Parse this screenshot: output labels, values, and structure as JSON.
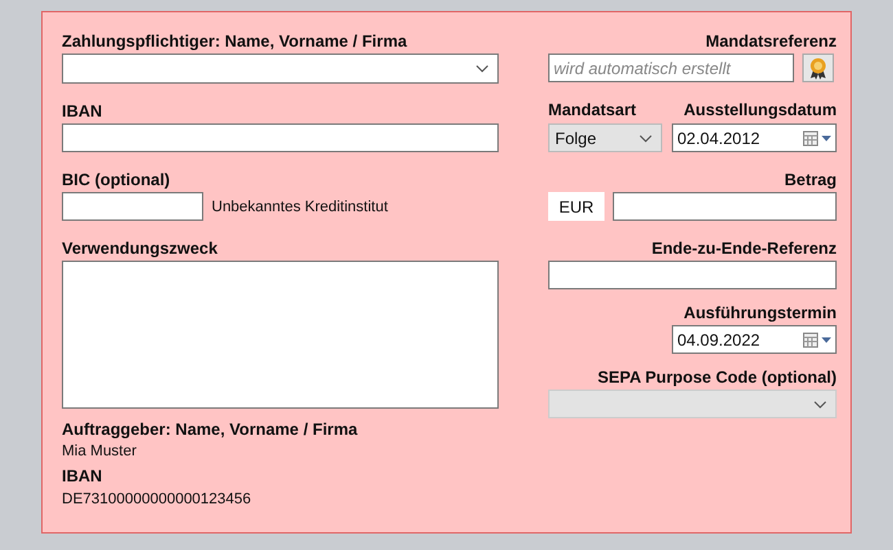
{
  "payer": {
    "label": "Zahlungspflichtiger: Name, Vorname / Firma"
  },
  "iban": {
    "label": "IBAN"
  },
  "bic": {
    "label": "BIC (optional)",
    "bank": "Unbekanntes Kreditinstitut"
  },
  "purpose": {
    "label": "Verwendungszweck"
  },
  "originator": {
    "label": "Auftraggeber: Name, Vorname / Firma",
    "name": "Mia Muster",
    "iban_label": "IBAN",
    "iban": "DE73100000000000123456"
  },
  "mandate_reference": {
    "label": "Mandatsreferenz",
    "placeholder": "wird automatisch erstellt"
  },
  "mandate_type": {
    "label": "Mandatsart",
    "value": "Folge"
  },
  "issue_date": {
    "label": "Ausstellungsdatum",
    "value": "02.04.2012"
  },
  "amount": {
    "label": "Betrag",
    "currency": "EUR"
  },
  "end_to_end": {
    "label": "Ende-zu-Ende-Referenz"
  },
  "execution_date": {
    "label": "Ausführungstermin",
    "value": "04.09.2022"
  },
  "purpose_code": {
    "label": "SEPA Purpose Code (optional)",
    "disabled": true
  }
}
